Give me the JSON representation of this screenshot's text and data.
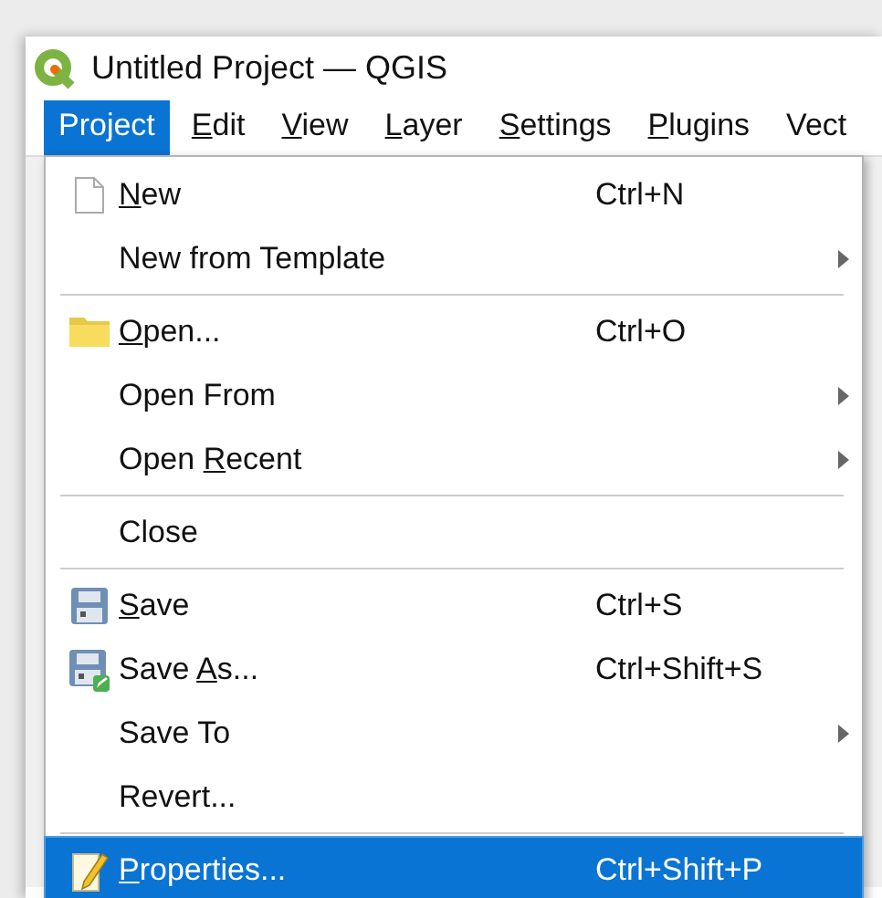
{
  "window": {
    "title": "Untitled Project — QGIS"
  },
  "menu_bar": [
    {
      "label": [
        {
          "text": "Project",
          "underline": false
        }
      ],
      "selected": true
    },
    {
      "label": [
        {
          "text": "E",
          "underline": true
        },
        {
          "text": "dit",
          "underline": false
        }
      ],
      "selected": false
    },
    {
      "label": [
        {
          "text": "V",
          "underline": true
        },
        {
          "text": "iew",
          "underline": false
        }
      ],
      "selected": false
    },
    {
      "label": [
        {
          "text": "L",
          "underline": true
        },
        {
          "text": "ayer",
          "underline": false
        }
      ],
      "selected": false
    },
    {
      "label": [
        {
          "text": "S",
          "underline": true
        },
        {
          "text": "ettings",
          "underline": false
        }
      ],
      "selected": false
    },
    {
      "label": [
        {
          "text": "P",
          "underline": true
        },
        {
          "text": "lugins",
          "underline": false
        }
      ],
      "selected": false
    },
    {
      "label": [
        {
          "text": "Vect",
          "underline": false
        }
      ],
      "selected": false
    }
  ],
  "menu": [
    {
      "kind": "item",
      "label": [
        {
          "text": "N",
          "underline": true
        },
        {
          "text": "ew",
          "underline": false
        }
      ],
      "shortcut": "Ctrl+N",
      "submenu": false,
      "selected": false
    },
    {
      "kind": "item",
      "label": [
        {
          "text": "New from Template",
          "underline": false
        }
      ],
      "submenu": true,
      "selected": false
    },
    {
      "kind": "separator"
    },
    {
      "kind": "item",
      "label": [
        {
          "text": "O",
          "underline": true
        },
        {
          "text": "pen...",
          "underline": false
        }
      ],
      "shortcut": "Ctrl+O",
      "submenu": false,
      "selected": false
    },
    {
      "kind": "item",
      "label": [
        {
          "text": "Open From",
          "underline": false
        }
      ],
      "submenu": true,
      "selected": false
    },
    {
      "kind": "item",
      "label": [
        {
          "text": "Open ",
          "underline": false
        },
        {
          "text": "R",
          "underline": true
        },
        {
          "text": "ecent",
          "underline": false
        }
      ],
      "submenu": true,
      "selected": false
    },
    {
      "kind": "separator"
    },
    {
      "kind": "item",
      "label": [
        {
          "text": "Close",
          "underline": false
        }
      ],
      "submenu": false,
      "selected": false
    },
    {
      "kind": "separator"
    },
    {
      "kind": "item",
      "label": [
        {
          "text": "S",
          "underline": true
        },
        {
          "text": "ave",
          "underline": false
        }
      ],
      "shortcut": "Ctrl+S",
      "submenu": false,
      "selected": false
    },
    {
      "kind": "item",
      "label": [
        {
          "text": "Save ",
          "underline": false
        },
        {
          "text": "A",
          "underline": true
        },
        {
          "text": "s...",
          "underline": false
        }
      ],
      "shortcut": "Ctrl+Shift+S",
      "submenu": false,
      "selected": false
    },
    {
      "kind": "item",
      "label": [
        {
          "text": "Save To",
          "underline": false
        }
      ],
      "submenu": true,
      "selected": false
    },
    {
      "kind": "item",
      "label": [
        {
          "text": "Revert...",
          "underline": false
        }
      ],
      "submenu": false,
      "selected": false
    },
    {
      "kind": "separator"
    },
    {
      "kind": "item",
      "label": [
        {
          "text": "P",
          "underline": true
        },
        {
          "text": "roperties...",
          "underline": false
        }
      ],
      "shortcut": "Ctrl+Shift+P",
      "submenu": false,
      "selected": true
    }
  ]
}
